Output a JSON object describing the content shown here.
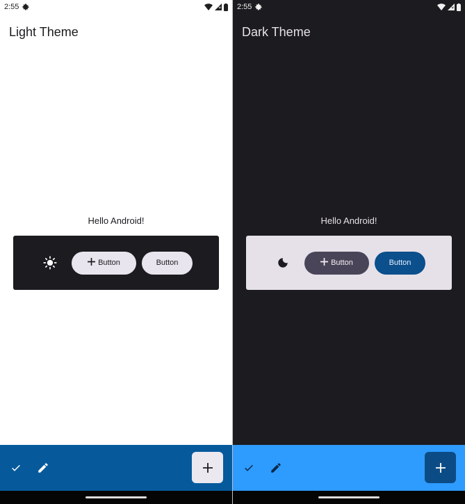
{
  "light": {
    "status": {
      "time": "2:55"
    },
    "title": "Light Theme",
    "greeting": "Hello Android!",
    "theme_icon": "sun-icon",
    "buttons": {
      "icon_button_label": "Button",
      "text_button_label": "Button"
    },
    "bottom_bar": {
      "check_icon": "check-icon",
      "edit_icon": "edit-icon",
      "fab_icon": "plus-icon"
    },
    "colors": {
      "background": "#ffffff",
      "panel": "#1c1b1f",
      "bottom_bar": "#065a9c",
      "fab": "#ece8f0"
    }
  },
  "dark": {
    "status": {
      "time": "2:55"
    },
    "title": "Dark Theme",
    "greeting": "Hello Android!",
    "theme_icon": "moon-icon",
    "buttons": {
      "icon_button_label": "Button",
      "text_button_label": "Button"
    },
    "bottom_bar": {
      "check_icon": "check-icon",
      "edit_icon": "edit-icon",
      "fab_icon": "plus-icon"
    },
    "colors": {
      "background": "#1c1b1f",
      "panel": "#e6e1e9",
      "bottom_bar": "#2e9bff",
      "fab": "#0c4c86",
      "primary_button": "#0b4f8c"
    }
  }
}
